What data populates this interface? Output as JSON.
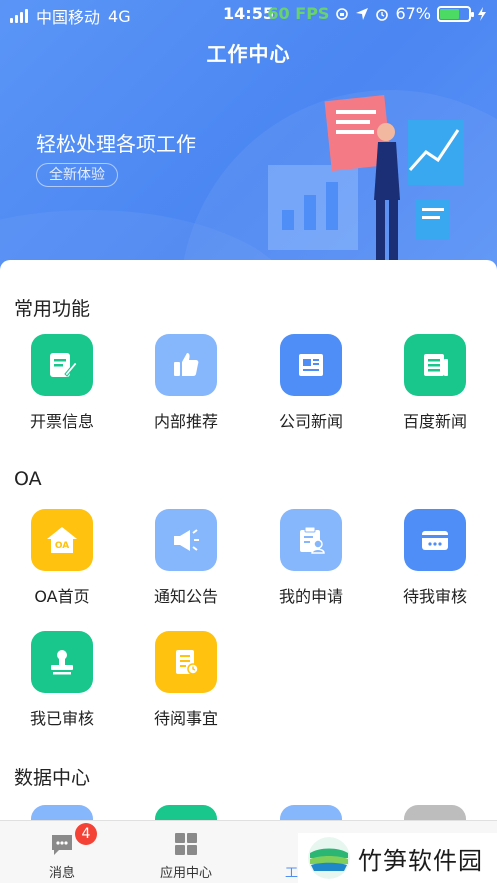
{
  "status_bar": {
    "carrier": "中国移动",
    "network": "4G",
    "time": "14:55",
    "fps": "60 FPS",
    "battery": "67%"
  },
  "header": {
    "title": "工作中心"
  },
  "banner": {
    "title": "轻松处理各项工作",
    "badge": "全新体验"
  },
  "sections": {
    "common": {
      "title": "常用功能",
      "items": [
        {
          "label": "开票信息",
          "icon": "invoice-edit-icon",
          "color": "#19c68c"
        },
        {
          "label": "内部推荐",
          "icon": "thumbs-up-icon",
          "color": "#86b6fb"
        },
        {
          "label": "公司新闻",
          "icon": "news-icon",
          "color": "#4f8ef6"
        },
        {
          "label": "百度新闻",
          "icon": "newspaper-icon",
          "color": "#19c68c"
        }
      ]
    },
    "oa": {
      "title": "OA",
      "items": [
        {
          "label": "OA首页",
          "icon": "oa-home-icon",
          "color": "#ffc20e"
        },
        {
          "label": "通知公告",
          "icon": "megaphone-icon",
          "color": "#86b6fb"
        },
        {
          "label": "我的申请",
          "icon": "clipboard-user-icon",
          "color": "#86b6fb"
        },
        {
          "label": "待我审核",
          "icon": "card-icon",
          "color": "#4f8ef6"
        },
        {
          "label": "我已审核",
          "icon": "stamp-icon",
          "color": "#19c68c"
        },
        {
          "label": "待阅事宜",
          "icon": "document-clock-icon",
          "color": "#ffc20e"
        }
      ]
    },
    "data": {
      "title": "数据中心"
    }
  },
  "oa_icon_text": "OA",
  "tabbar": {
    "messages": {
      "label": "消息",
      "badge": "4"
    },
    "apps": {
      "label": "应用中心"
    },
    "work": {
      "label": "工"
    }
  },
  "watermark": {
    "text": "竹笋软件园"
  }
}
